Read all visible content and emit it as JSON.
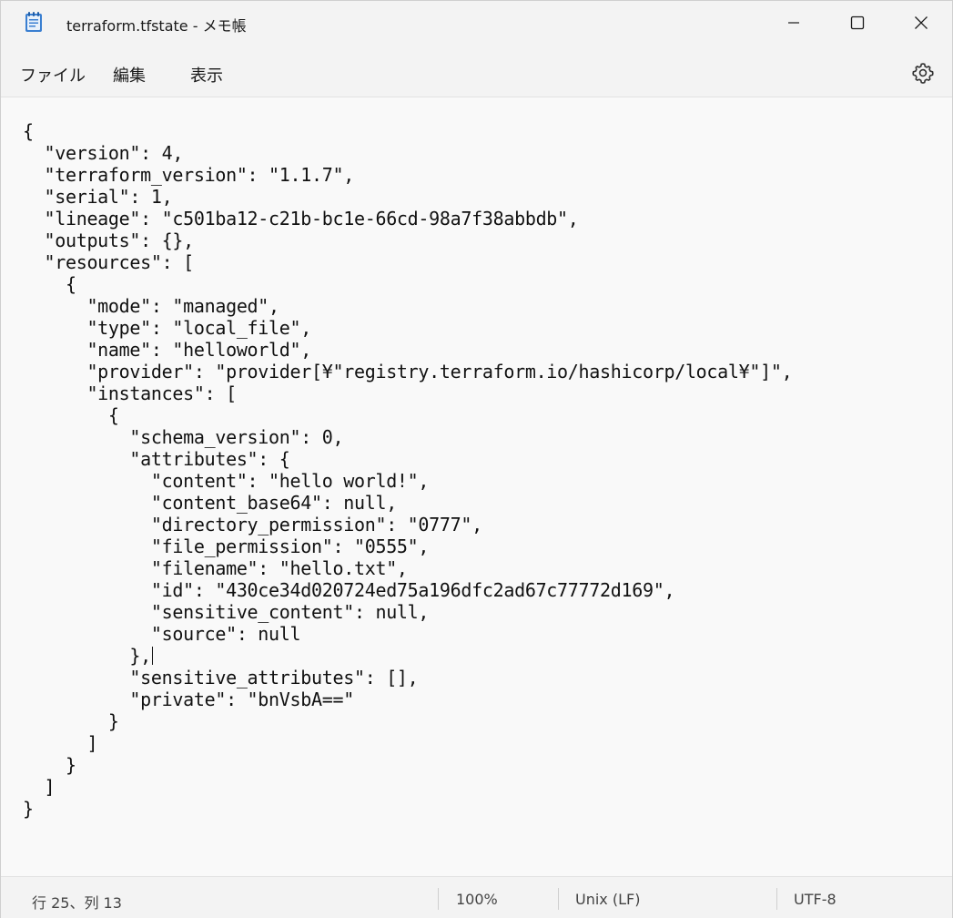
{
  "window": {
    "title": "terraform.tfstate - メモ帳"
  },
  "menu": {
    "file": "ファイル",
    "edit": "編集",
    "view": "表示"
  },
  "editor": {
    "lines": [
      "{",
      "  \"version\": 4,",
      "  \"terraform_version\": \"1.1.7\",",
      "  \"serial\": 1,",
      "  \"lineage\": \"c501ba12-c21b-bc1e-66cd-98a7f38abbdb\",",
      "  \"outputs\": {},",
      "  \"resources\": [",
      "    {",
      "      \"mode\": \"managed\",",
      "      \"type\": \"local_file\",",
      "      \"name\": \"helloworld\",",
      "      \"provider\": \"provider[¥\"registry.terraform.io/hashicorp/local¥\"]\",",
      "      \"instances\": [",
      "        {",
      "          \"schema_version\": 0,",
      "          \"attributes\": {",
      "            \"content\": \"hello world!\",",
      "            \"content_base64\": null,",
      "            \"directory_permission\": \"0777\",",
      "            \"file_permission\": \"0555\",",
      "            \"filename\": \"hello.txt\",",
      "            \"id\": \"430ce34d020724ed75a196dfc2ad67c77772d169\",",
      "            \"sensitive_content\": null,",
      "            \"source\": null",
      "          },",
      "          \"sensitive_attributes\": [],",
      "          \"private\": \"bnVsbA==\"",
      "        }",
      "      ]",
      "    }",
      "  ]",
      "}"
    ]
  },
  "status": {
    "position": "行 25、列 13",
    "zoom": "100%",
    "line_ending": "Unix (LF)",
    "encoding": "UTF-8"
  }
}
